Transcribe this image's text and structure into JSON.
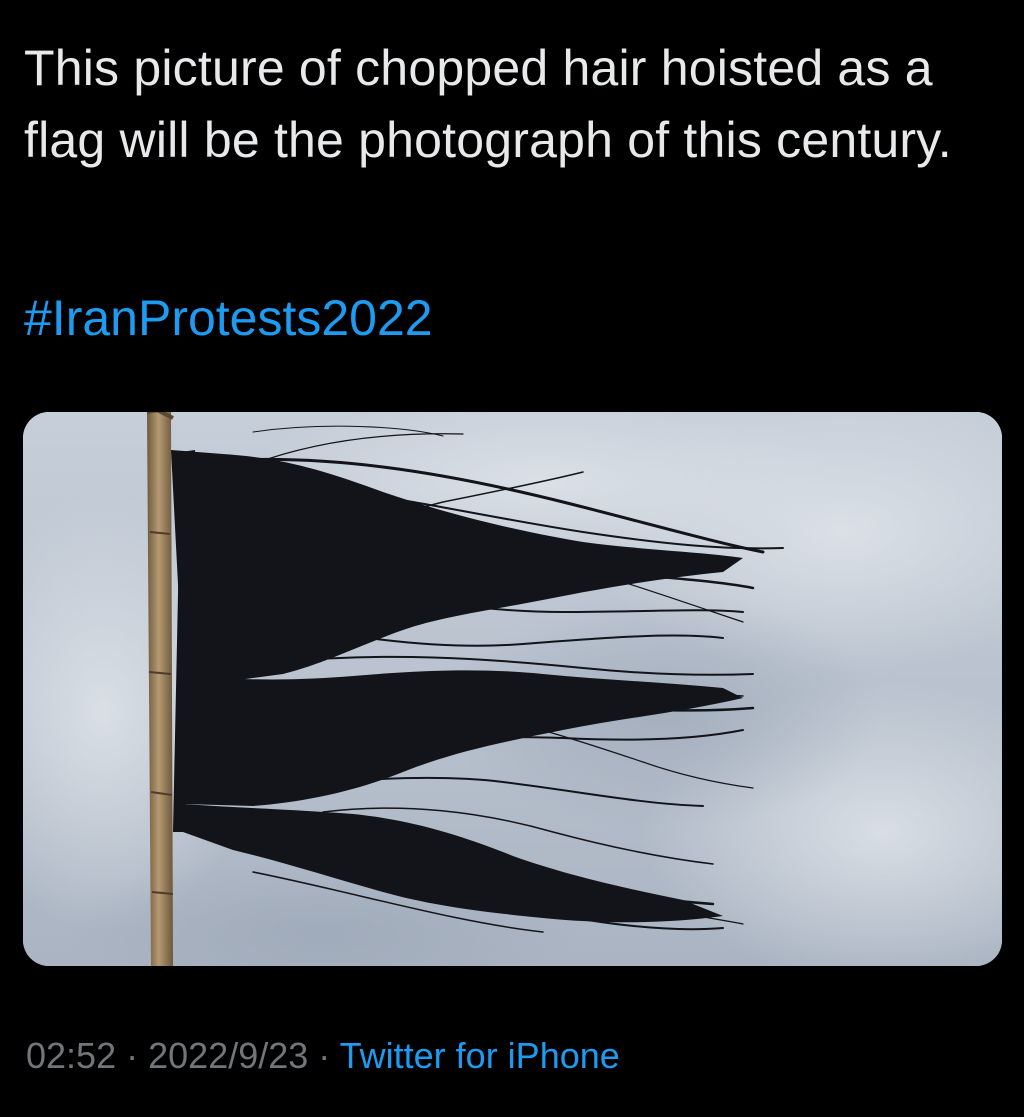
{
  "tweet": {
    "text": "This picture of chopped hair hoisted as a flag will be the photograph of this century.",
    "hashtag": "#IranProtests2022",
    "media_subject": "black-hair-flag-on-pole",
    "time": "02:52",
    "separator": "·",
    "date": "2022/9/23",
    "source": "Twitter for iPhone"
  },
  "colors": {
    "background": "#000000",
    "text": "#e7e9ea",
    "link": "#1d9bf0",
    "muted": "#71767b",
    "sky": "#c3cbd6",
    "hair": "#121419",
    "pole": "#a08560"
  }
}
